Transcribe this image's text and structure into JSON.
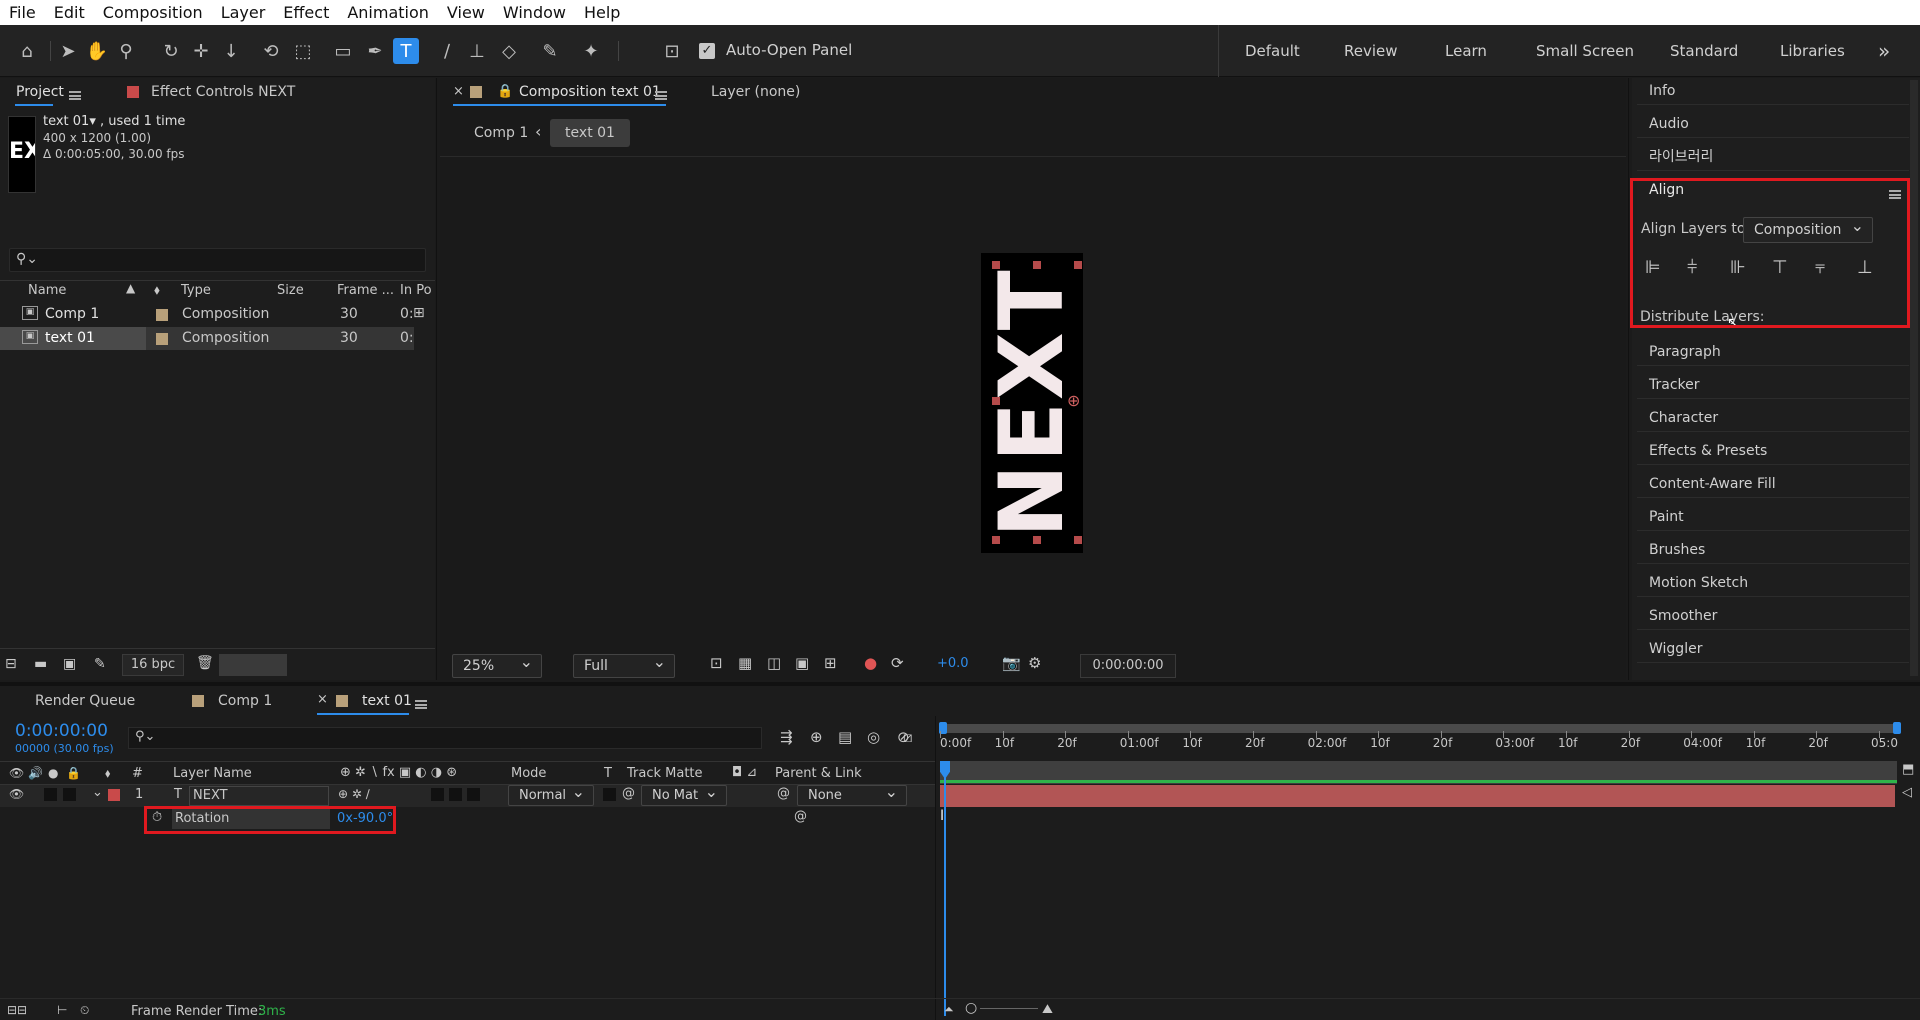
{
  "menubar": {
    "items": [
      "File",
      "Edit",
      "Composition",
      "Layer",
      "Effect",
      "Animation",
      "View",
      "Window",
      "Help"
    ]
  },
  "toolbar": {
    "auto_open_panel": "Auto-Open Panel",
    "workspaces": [
      "Default",
      "Review",
      "Learn",
      "Small Screen",
      "Standard",
      "Libraries"
    ],
    "more": "»",
    "accent": "#2d8ceb"
  },
  "project_panel": {
    "tab_project": "Project",
    "tab_effect_controls": "Effect Controls NEXT",
    "thumb_text": "EX",
    "info_name": "text 01▾ , used 1 time",
    "info_size": "400 x 1200 (1.00)",
    "info_duration": "Δ 0:00:05:00, 30.00 fps",
    "search_placeholder": "",
    "columns": [
      "Name",
      "Type",
      "Size",
      "Frame ...",
      "In Po"
    ],
    "rows": [
      {
        "name": "Comp 1",
        "type": "Composition",
        "size": "",
        "frame": "30",
        "in": "0:"
      },
      {
        "name": "text 01",
        "type": "Composition",
        "size": "",
        "frame": "30",
        "in": "0:"
      }
    ],
    "bpc": "16 bpc"
  },
  "composition_panel": {
    "tab_label": "Composition text 01",
    "layer_tab": "Layer (none)",
    "breadcrumb_parent": "Comp 1",
    "breadcrumb_current": "text 01",
    "canvas_text": "NEXT",
    "zoom": "25%",
    "resolution": "Full",
    "exposure": "+0.0",
    "timecode": "0:00:00:00"
  },
  "right_panel": {
    "items_top": [
      "Info",
      "Audio",
      "라이브러리"
    ],
    "align_title": "Align",
    "align_layers_to_label": "Align Layers to:",
    "align_layers_to_value": "Composition",
    "distribute_label": "Distribute Layers:",
    "items_bottom": [
      "Paragraph",
      "Tracker",
      "Character",
      "Effects & Presets",
      "Content-Aware Fill",
      "Paint",
      "Brushes",
      "Motion Sketch",
      "Smoother",
      "Wiggler"
    ]
  },
  "timeline": {
    "tab_render_queue": "Render Queue",
    "tab_comp1": "Comp 1",
    "tab_text01": "text 01",
    "timecode": "0:00:00:00",
    "fps": "00000 (30.00 fps)",
    "columns": {
      "layer_name": "Layer Name",
      "num": "#",
      "mode": "Mode",
      "t": "T",
      "track_matte": "Track Matte",
      "parent": "Parent & Link"
    },
    "layer": {
      "index": "1",
      "name": "NEXT",
      "mode": "Normal",
      "track_matte": "No Mat",
      "parent": "None"
    },
    "property": {
      "name": "Rotation",
      "value": "0x-90.0°"
    },
    "ruler": [
      "0:00f",
      "10f",
      "20f",
      "01:00f",
      "10f",
      "20f",
      "02:00f",
      "10f",
      "20f",
      "03:00f",
      "10f",
      "20f",
      "04:00f",
      "10f",
      "20f",
      "05:0"
    ],
    "frame_render_label": "Frame Render Time:",
    "frame_render_value": "3ms"
  }
}
